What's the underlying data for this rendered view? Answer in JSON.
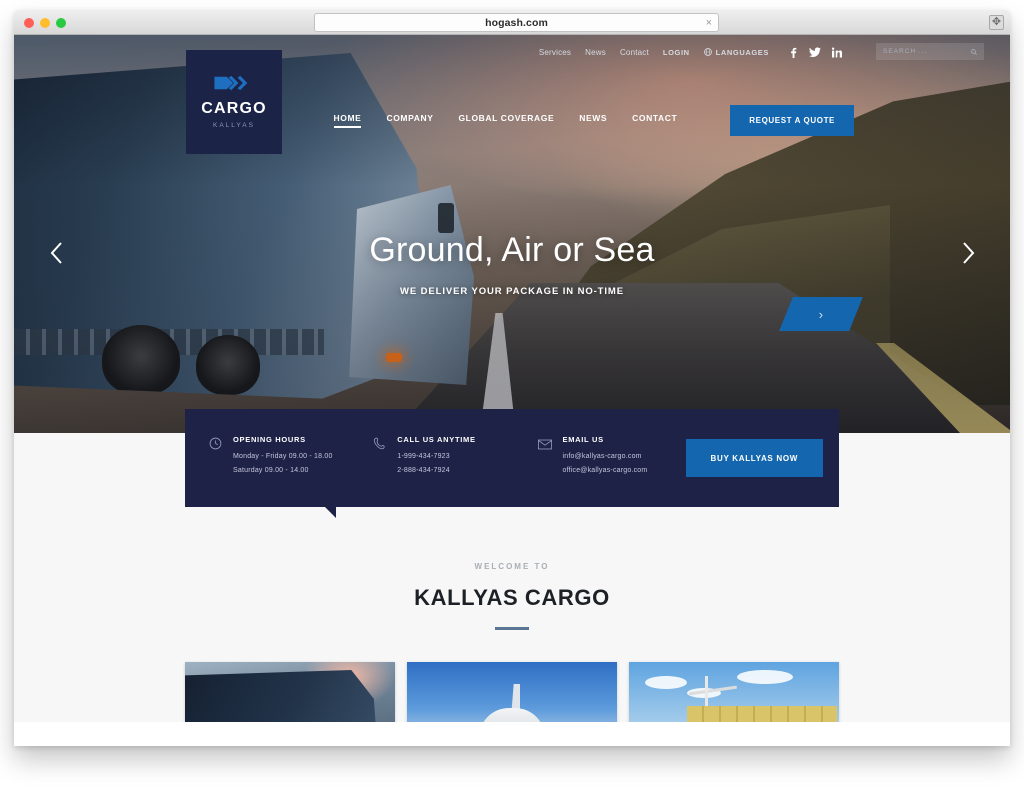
{
  "browser": {
    "url": "hogash.com",
    "close_label": "×",
    "widget_label": "✥",
    "traffic_lights": [
      "close",
      "minimize",
      "zoom"
    ]
  },
  "header": {
    "logo": {
      "mark": "cargo-arrow-logo",
      "name": "CARGO",
      "tagline": "KALLYAS"
    },
    "topbar": {
      "links": [
        "Services",
        "News",
        "Contact"
      ],
      "login_label": "LOGIN",
      "languages_label": "LANGUAGES",
      "languages_icon": "globe-icon",
      "socials": [
        {
          "name": "facebook-icon",
          "glyph": "f"
        },
        {
          "name": "twitter-icon",
          "glyph": "t"
        },
        {
          "name": "linkedin-icon",
          "glyph": "in"
        }
      ],
      "search": {
        "placeholder": "SEARCH ...",
        "value": "",
        "icon": "search-icon"
      }
    },
    "nav": {
      "items": [
        {
          "label": "HOME",
          "active": true
        },
        {
          "label": "COMPANY",
          "active": false
        },
        {
          "label": "GLOBAL COVERAGE",
          "active": false
        },
        {
          "label": "NEWS",
          "active": false
        },
        {
          "label": "CONTACT",
          "active": false
        }
      ],
      "cta_label": "REQUEST A QUOTE",
      "cta_color": "#1466ae"
    }
  },
  "hero": {
    "title": "Ground, Air or Sea",
    "subtitle": "WE DELIVER YOUR PACKAGE IN NO-TIME",
    "cta_icon": "chevron-right-icon",
    "prev_icon": "chevron-left-icon",
    "next_icon": "chevron-right-icon",
    "image_alt": "cargo-truck-on-mountain-road"
  },
  "infobar": {
    "background": "#1f2247",
    "columns": [
      {
        "icon": "clock-icon",
        "title": "OPENING HOURS",
        "lines": [
          "Monday - Friday 09.00 - 18.00",
          "Saturday 09.00 - 14.00"
        ]
      },
      {
        "icon": "phone-icon",
        "title": "CALL US ANYTIME",
        "lines": [
          "1-999-434-7923",
          "2-888-434-7924"
        ]
      },
      {
        "icon": "envelope-icon",
        "title": "EMAIL US",
        "lines": [
          "info@kallyas-cargo.com",
          "office@kallyas-cargo.com"
        ]
      }
    ],
    "buy_label": "BUY KALLYAS NOW",
    "buy_color": "#1466ae"
  },
  "welcome": {
    "kicker": "WELCOME TO",
    "title": "KALLYAS CARGO",
    "rule_color": "#5b7594"
  },
  "cards": [
    {
      "name": "card-ground-truck",
      "alt": "cargo truck at sunset"
    },
    {
      "name": "card-air-plane",
      "alt": "cargo airplane on runway"
    },
    {
      "name": "card-sea-ship",
      "alt": "container ship with cranes"
    }
  ]
}
